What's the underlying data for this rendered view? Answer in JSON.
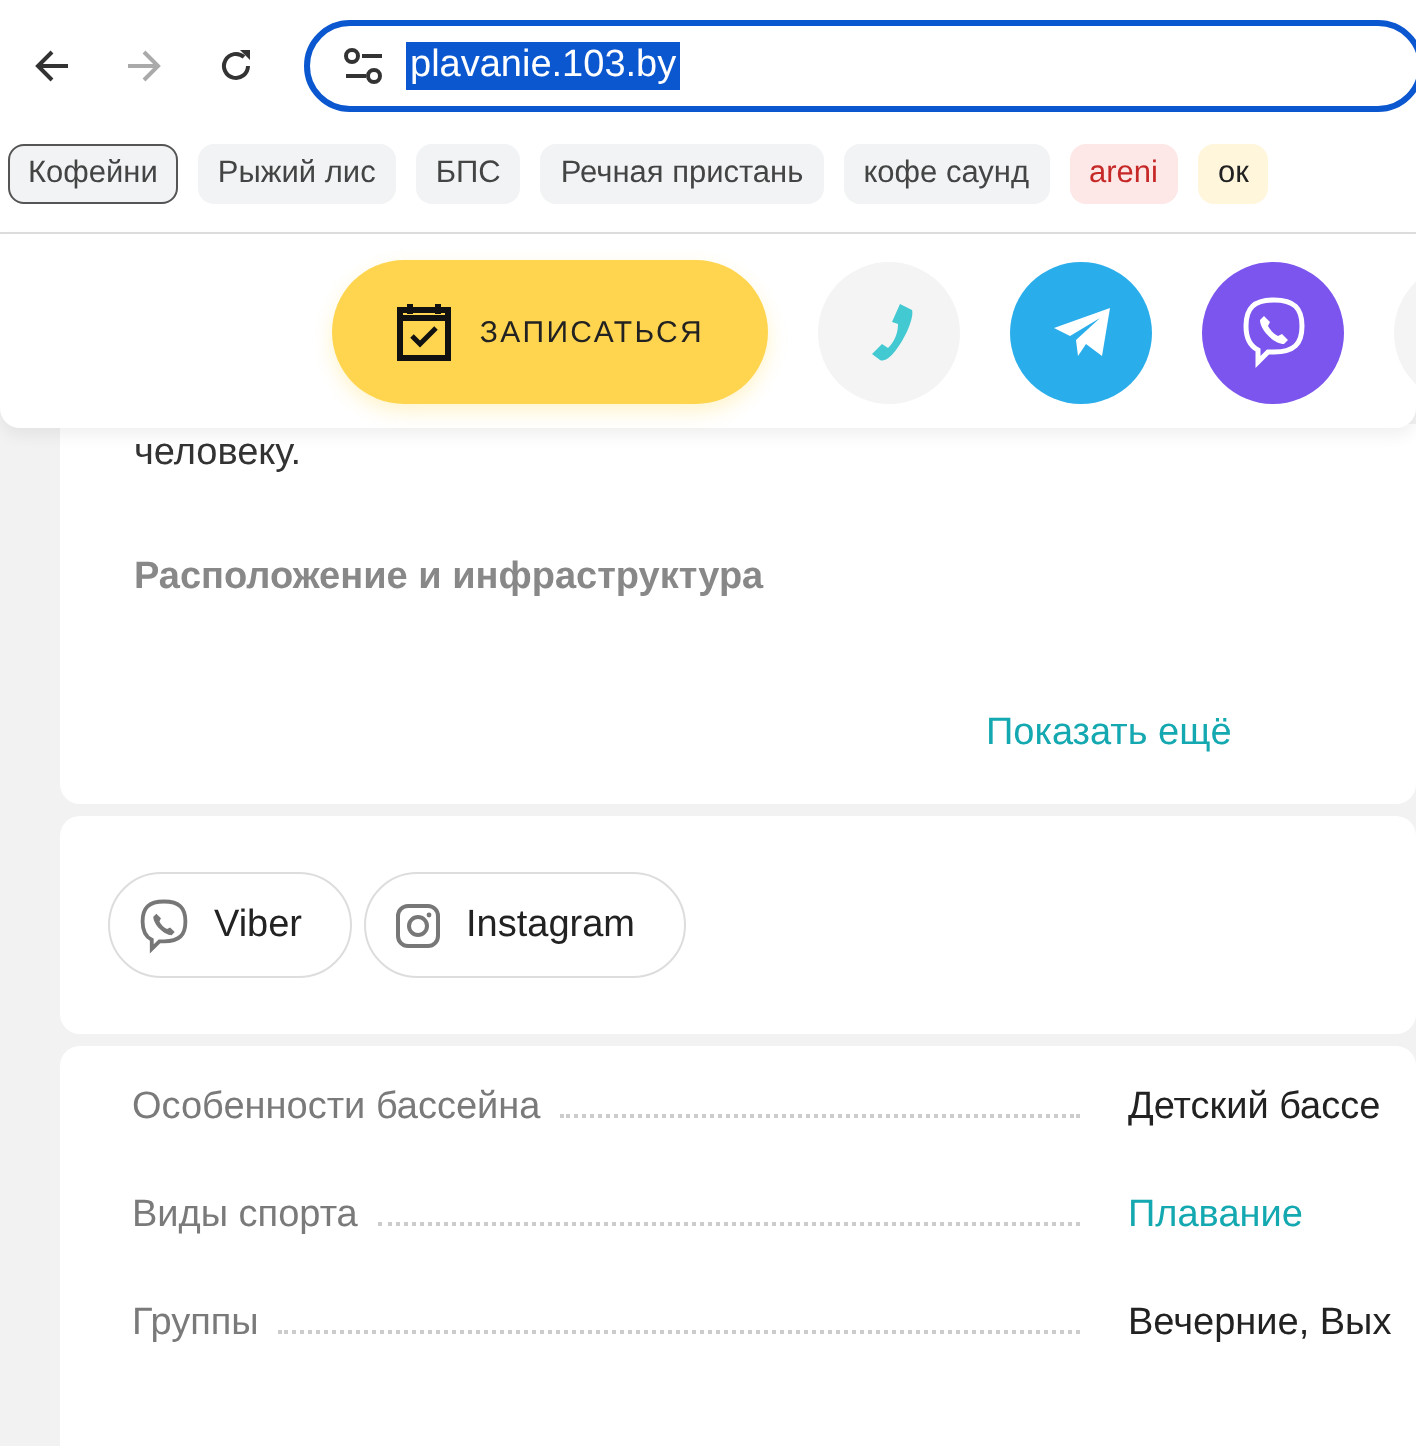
{
  "browser": {
    "address": "plavanie.103.by",
    "forward_disabled": true
  },
  "bookmarks": [
    {
      "label": "Кофейни",
      "selected": true,
      "color": "#444444"
    },
    {
      "label": "Рыжий лис",
      "selected": false,
      "color": "#444444"
    },
    {
      "label": "БПС",
      "selected": false,
      "color": "#444444"
    },
    {
      "label": "Речная пристань",
      "selected": false,
      "color": "#444444"
    },
    {
      "label": "кофе саунд",
      "selected": false,
      "color": "#444444"
    },
    {
      "label": "areni",
      "selected": false,
      "color": "#c62828"
    },
    {
      "label": "ок",
      "selected": false,
      "color": "#222222"
    }
  ],
  "action_bar": {
    "signup_button": "ЗАПИСАТЬСЯ",
    "contacts": [
      {
        "kind": "phone"
      },
      {
        "kind": "telegram"
      },
      {
        "kind": "viber"
      },
      {
        "kind": "more"
      }
    ]
  },
  "description": {
    "text_tail": "человеку.",
    "heading": "Расположение и инфраструктура",
    "show_more": "Показать ещё"
  },
  "social_links": [
    {
      "kind": "viber",
      "label": "Viber"
    },
    {
      "kind": "instagram",
      "label": "Instagram"
    }
  ],
  "details": [
    {
      "label": "Особенности бассейна",
      "value": "Детский бассе",
      "link": false
    },
    {
      "label": "Виды спорта",
      "value": "Плавание",
      "link": true
    },
    {
      "label": "Группы",
      "value": "Вечерние, Вых",
      "link": false
    }
  ]
}
